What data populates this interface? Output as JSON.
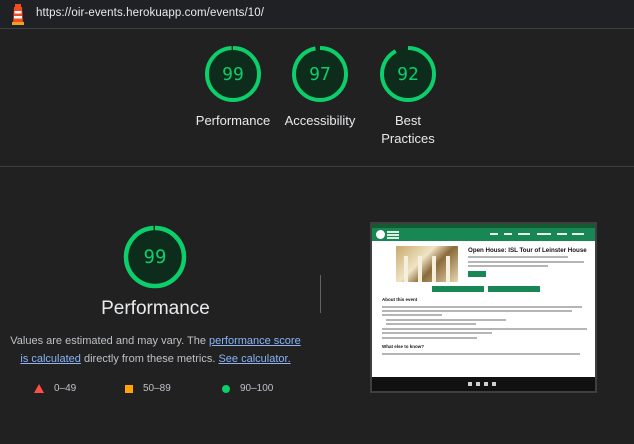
{
  "url": "https://oir-events.herokuapp.com/events/10/",
  "colors": {
    "pass": "#0cce6b",
    "average": "#ffa400",
    "fail": "#ff4e42",
    "link": "#8ab4f8"
  },
  "summary": [
    {
      "label": "Performance",
      "score": "99"
    },
    {
      "label": "Accessibility",
      "score": "97"
    },
    {
      "label_line1": "Best",
      "label_line2": "Practices",
      "score": "92"
    }
  ],
  "performance": {
    "score": "99",
    "title": "Performance",
    "note_text_1": "Values are estimated and may vary. The ",
    "note_link_1": "performance score is calculated",
    "note_text_2": " directly from these metrics. ",
    "note_link_2": "See calculator."
  },
  "legend": {
    "fail_range": "0–49",
    "average_range": "50–89",
    "pass_range": "90–100"
  },
  "thumbnail": {
    "event_title": "Open House: ISL Tour of Leinster House",
    "about_heading": "About this event",
    "what_else_heading": "What else to know?"
  }
}
